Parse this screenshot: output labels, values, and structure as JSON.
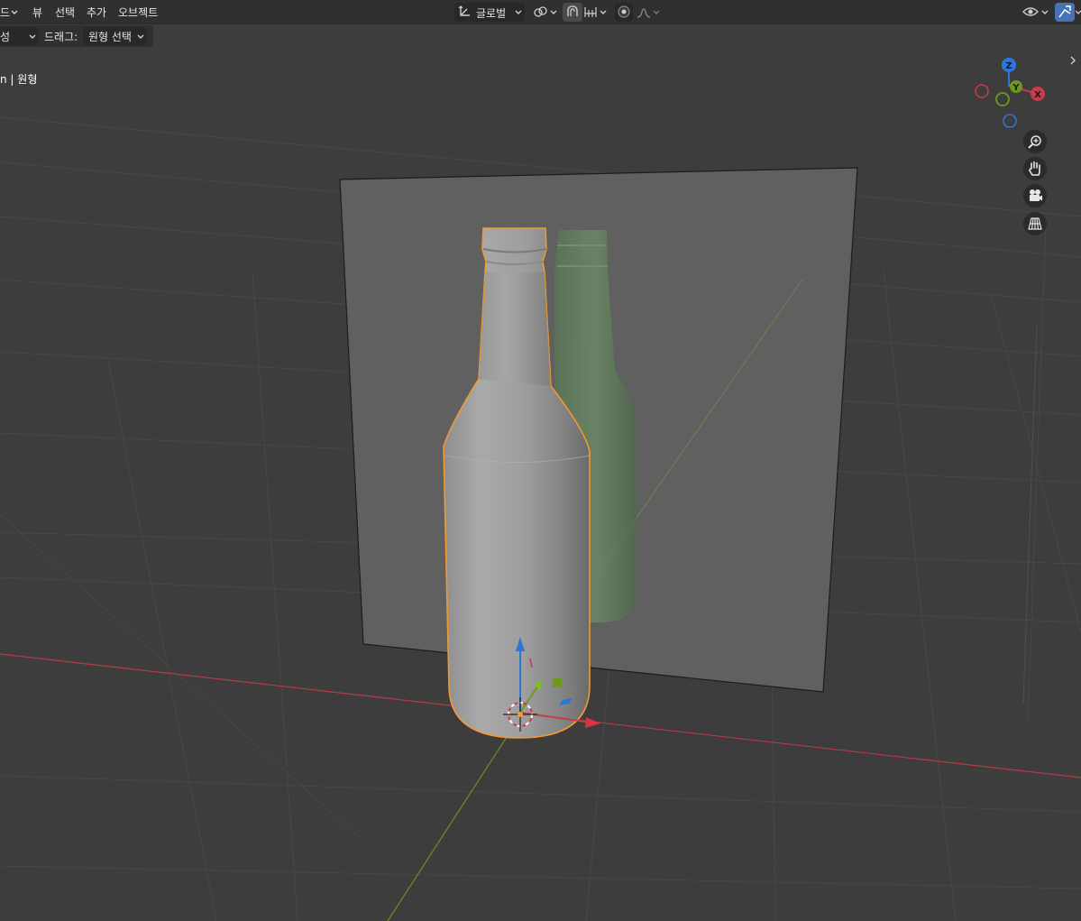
{
  "header": {
    "mode_fragment": "드",
    "menu": {
      "view": "뷰",
      "select": "선택",
      "add": "추가",
      "object": "오브젝트"
    },
    "transform_orientation": "글로벌"
  },
  "tool_settings": {
    "mode_fragment": "성",
    "drag_label": "드래그:",
    "drag_value": "원형 선택"
  },
  "viewport": {
    "breadcrumb": "n | 원형"
  },
  "gizmo": {
    "z": "Z",
    "y": "Y",
    "x": "X"
  },
  "colors": {
    "header_bg": "#303030",
    "viewport_bg": "#3d3d3d",
    "selection_outline": "#f29a2e",
    "x_axis": "#c63d49",
    "y_axis": "#6d9a1e",
    "z_axis": "#2d75d6",
    "ghost_bottle": "#5e8a57"
  },
  "icons": [
    "transform-orientation-icon",
    "pivot-point-icon",
    "snap-icon",
    "snap-increment-icon",
    "proportional-editing-icon",
    "falloff-icon",
    "visibility-icon",
    "gizmo-toggle-icon",
    "zoom-icon",
    "hand-pan-icon",
    "camera-icon",
    "perspective-grid-icon",
    "sidebar-toggle-icon",
    "3d-cursor-icon"
  ]
}
